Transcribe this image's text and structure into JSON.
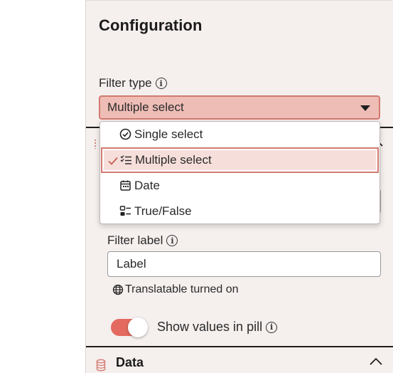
{
  "panel": {
    "title": "Configuration"
  },
  "filter_type": {
    "label": "Filter type",
    "selected": "Multiple select",
    "options": [
      {
        "label": "Single select",
        "icon": "check-circle-icon"
      },
      {
        "label": "Multiple select",
        "icon": "multi-select-list-icon",
        "selected": true
      },
      {
        "label": "Date",
        "icon": "calendar-icon"
      },
      {
        "label": "True/False",
        "icon": "boolean-toggle-icon"
      }
    ]
  },
  "filter_label": {
    "label": "Filter label",
    "value": "Label"
  },
  "translatable": {
    "text": "Translatable turned on",
    "icon": "globe-icon"
  },
  "show_values": {
    "label": "Show values in pill",
    "enabled": true
  },
  "data_section": {
    "label": "Data",
    "icon": "database-icon",
    "expanded": true
  },
  "colors": {
    "accent": "#e4695e",
    "accent_border": "#d27a70",
    "select_bg": "#eebdb6",
    "panel_bg": "#f5efee"
  }
}
